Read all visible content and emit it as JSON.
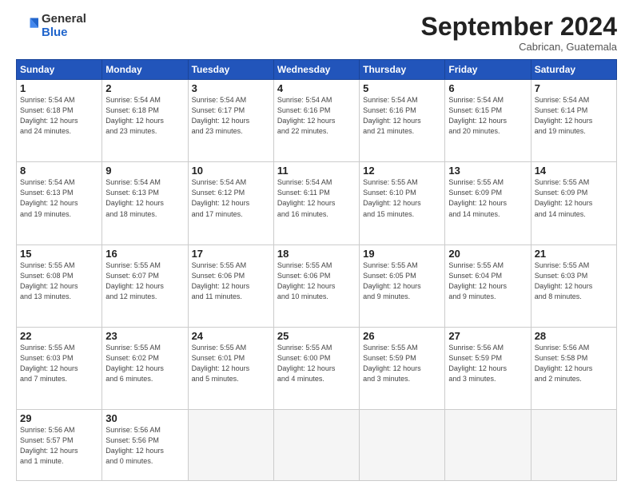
{
  "logo": {
    "general": "General",
    "blue": "Blue"
  },
  "title": "September 2024",
  "location": "Cabrican, Guatemala",
  "days_header": [
    "Sunday",
    "Monday",
    "Tuesday",
    "Wednesday",
    "Thursday",
    "Friday",
    "Saturday"
  ],
  "weeks": [
    [
      {
        "num": "1",
        "info": "Sunrise: 5:54 AM\nSunset: 6:18 PM\nDaylight: 12 hours\nand 24 minutes."
      },
      {
        "num": "2",
        "info": "Sunrise: 5:54 AM\nSunset: 6:18 PM\nDaylight: 12 hours\nand 23 minutes."
      },
      {
        "num": "3",
        "info": "Sunrise: 5:54 AM\nSunset: 6:17 PM\nDaylight: 12 hours\nand 23 minutes."
      },
      {
        "num": "4",
        "info": "Sunrise: 5:54 AM\nSunset: 6:16 PM\nDaylight: 12 hours\nand 22 minutes."
      },
      {
        "num": "5",
        "info": "Sunrise: 5:54 AM\nSunset: 6:16 PM\nDaylight: 12 hours\nand 21 minutes."
      },
      {
        "num": "6",
        "info": "Sunrise: 5:54 AM\nSunset: 6:15 PM\nDaylight: 12 hours\nand 20 minutes."
      },
      {
        "num": "7",
        "info": "Sunrise: 5:54 AM\nSunset: 6:14 PM\nDaylight: 12 hours\nand 19 minutes."
      }
    ],
    [
      {
        "num": "8",
        "info": "Sunrise: 5:54 AM\nSunset: 6:13 PM\nDaylight: 12 hours\nand 19 minutes."
      },
      {
        "num": "9",
        "info": "Sunrise: 5:54 AM\nSunset: 6:13 PM\nDaylight: 12 hours\nand 18 minutes."
      },
      {
        "num": "10",
        "info": "Sunrise: 5:54 AM\nSunset: 6:12 PM\nDaylight: 12 hours\nand 17 minutes."
      },
      {
        "num": "11",
        "info": "Sunrise: 5:54 AM\nSunset: 6:11 PM\nDaylight: 12 hours\nand 16 minutes."
      },
      {
        "num": "12",
        "info": "Sunrise: 5:55 AM\nSunset: 6:10 PM\nDaylight: 12 hours\nand 15 minutes."
      },
      {
        "num": "13",
        "info": "Sunrise: 5:55 AM\nSunset: 6:09 PM\nDaylight: 12 hours\nand 14 minutes."
      },
      {
        "num": "14",
        "info": "Sunrise: 5:55 AM\nSunset: 6:09 PM\nDaylight: 12 hours\nand 14 minutes."
      }
    ],
    [
      {
        "num": "15",
        "info": "Sunrise: 5:55 AM\nSunset: 6:08 PM\nDaylight: 12 hours\nand 13 minutes."
      },
      {
        "num": "16",
        "info": "Sunrise: 5:55 AM\nSunset: 6:07 PM\nDaylight: 12 hours\nand 12 minutes."
      },
      {
        "num": "17",
        "info": "Sunrise: 5:55 AM\nSunset: 6:06 PM\nDaylight: 12 hours\nand 11 minutes."
      },
      {
        "num": "18",
        "info": "Sunrise: 5:55 AM\nSunset: 6:06 PM\nDaylight: 12 hours\nand 10 minutes."
      },
      {
        "num": "19",
        "info": "Sunrise: 5:55 AM\nSunset: 6:05 PM\nDaylight: 12 hours\nand 9 minutes."
      },
      {
        "num": "20",
        "info": "Sunrise: 5:55 AM\nSunset: 6:04 PM\nDaylight: 12 hours\nand 9 minutes."
      },
      {
        "num": "21",
        "info": "Sunrise: 5:55 AM\nSunset: 6:03 PM\nDaylight: 12 hours\nand 8 minutes."
      }
    ],
    [
      {
        "num": "22",
        "info": "Sunrise: 5:55 AM\nSunset: 6:03 PM\nDaylight: 12 hours\nand 7 minutes."
      },
      {
        "num": "23",
        "info": "Sunrise: 5:55 AM\nSunset: 6:02 PM\nDaylight: 12 hours\nand 6 minutes."
      },
      {
        "num": "24",
        "info": "Sunrise: 5:55 AM\nSunset: 6:01 PM\nDaylight: 12 hours\nand 5 minutes."
      },
      {
        "num": "25",
        "info": "Sunrise: 5:55 AM\nSunset: 6:00 PM\nDaylight: 12 hours\nand 4 minutes."
      },
      {
        "num": "26",
        "info": "Sunrise: 5:55 AM\nSunset: 5:59 PM\nDaylight: 12 hours\nand 3 minutes."
      },
      {
        "num": "27",
        "info": "Sunrise: 5:56 AM\nSunset: 5:59 PM\nDaylight: 12 hours\nand 3 minutes."
      },
      {
        "num": "28",
        "info": "Sunrise: 5:56 AM\nSunset: 5:58 PM\nDaylight: 12 hours\nand 2 minutes."
      }
    ],
    [
      {
        "num": "29",
        "info": "Sunrise: 5:56 AM\nSunset: 5:57 PM\nDaylight: 12 hours\nand 1 minute."
      },
      {
        "num": "30",
        "info": "Sunrise: 5:56 AM\nSunset: 5:56 PM\nDaylight: 12 hours\nand 0 minutes."
      },
      null,
      null,
      null,
      null,
      null
    ]
  ]
}
